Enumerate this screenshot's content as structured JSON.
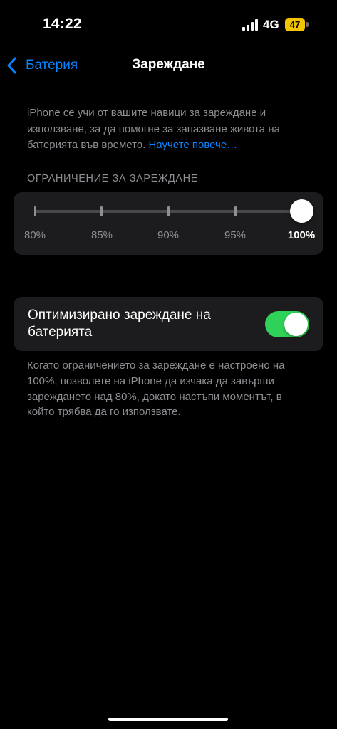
{
  "status_bar": {
    "time": "14:22",
    "network": "4G",
    "battery_level": "47",
    "battery_color": "#f5c400"
  },
  "nav": {
    "back_label": "Батерия",
    "back_icon": "chevron-left-icon",
    "title": "Зареждане"
  },
  "intro": {
    "text": "iPhone се учи от вашите навици за зареждане и използване, за да помогне за запазване живота на батерията във времето. ",
    "link": "Научете повече…"
  },
  "charge_limit": {
    "header": "ОГРАНИЧЕНИЕ ЗА ЗАРЕЖДАНЕ",
    "options": [
      "80%",
      "85%",
      "90%",
      "95%",
      "100%"
    ],
    "selected": "100%"
  },
  "optimized_charging": {
    "label": "Оптимизирано зареждане на батерията",
    "enabled": true,
    "toggle_color": "#30d158"
  },
  "footer": {
    "text": "Когато ограничението за зареждане е настроено на 100%, позволете на iPhone да изчака да завърши зареждането над 80%, докато настъпи моментът, в който трябва да го използвате."
  },
  "colors": {
    "accent": "#0a84ff",
    "background": "#000000",
    "card": "#1c1c1e",
    "secondary_text": "#8e8e93"
  }
}
